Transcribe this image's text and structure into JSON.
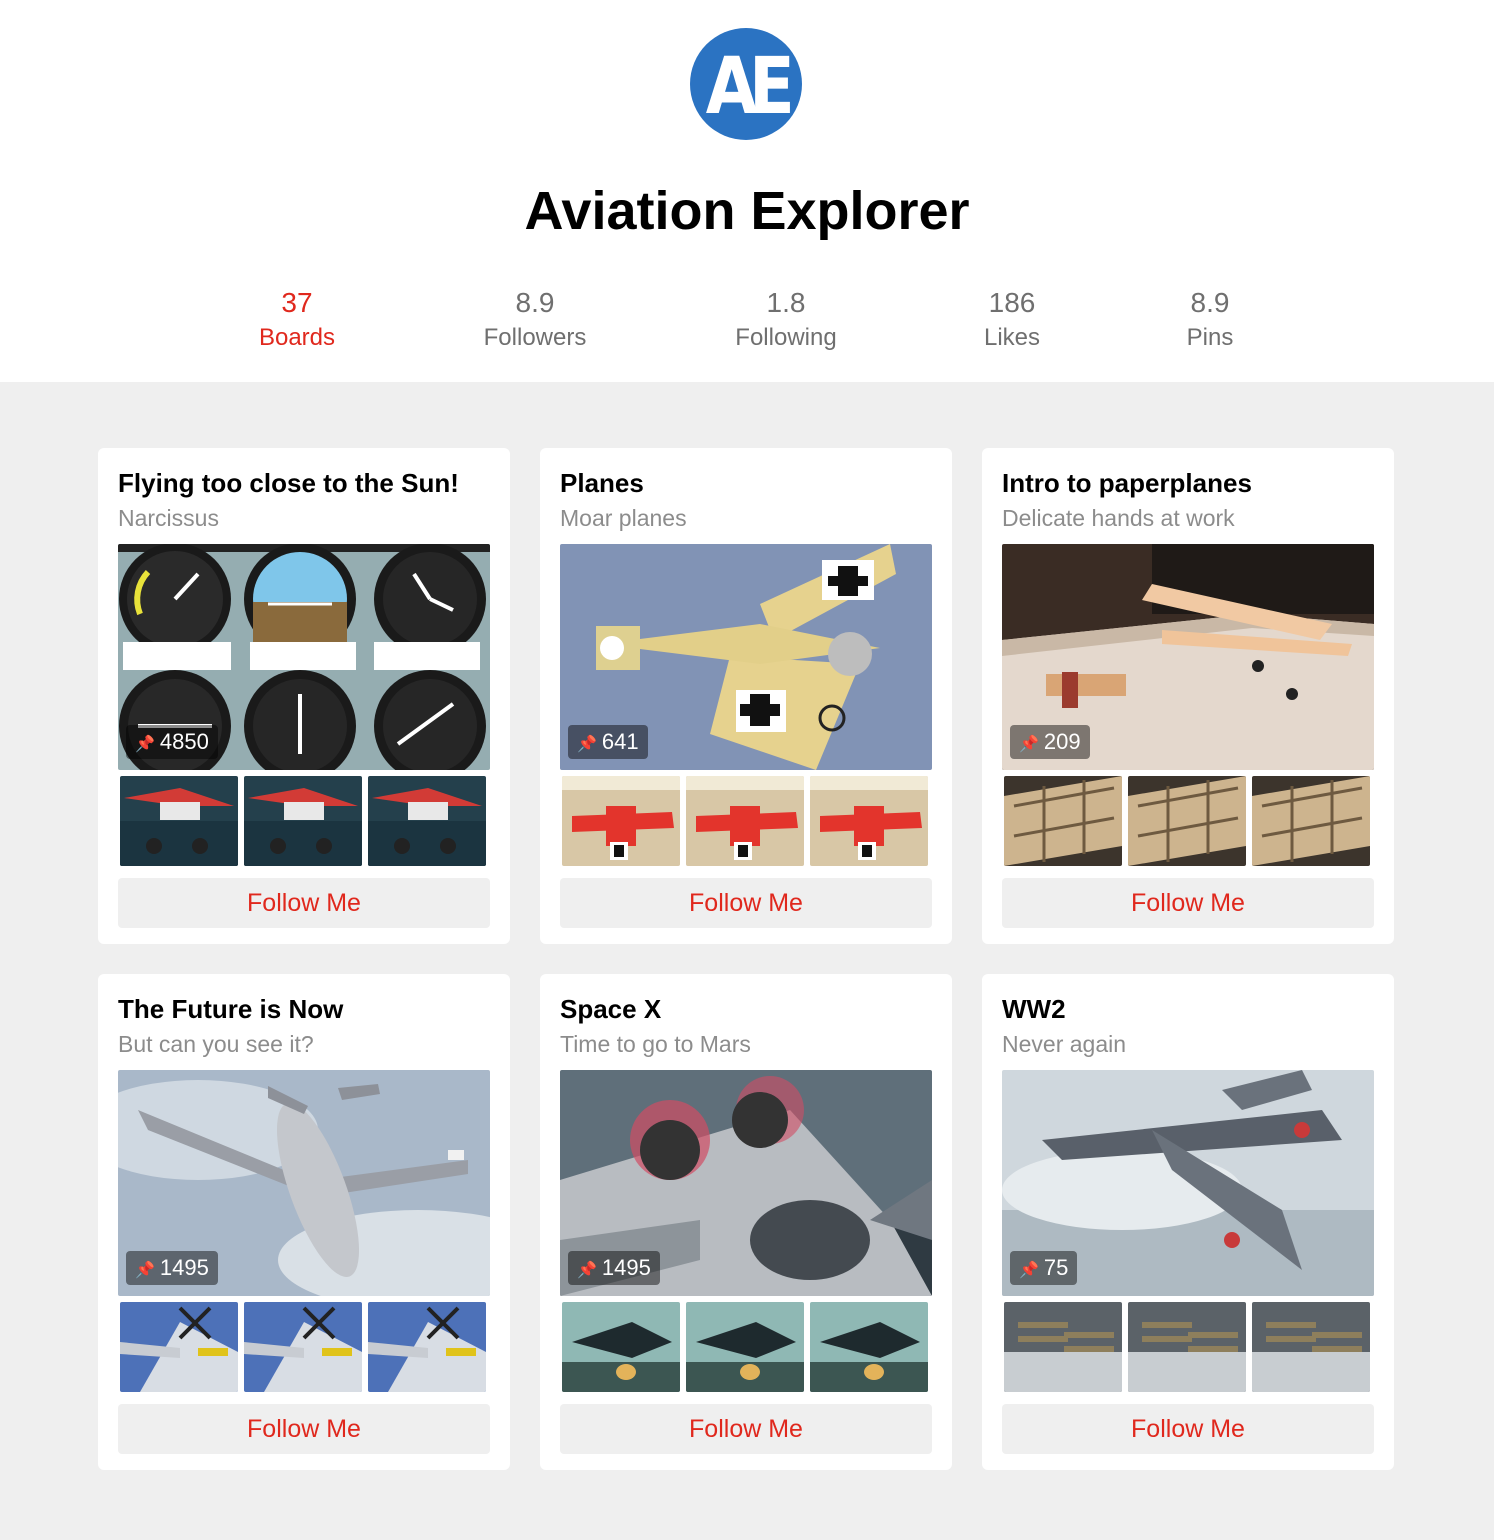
{
  "profile": {
    "logo_text": "AE",
    "name": "Aviation Explorer"
  },
  "stats": [
    {
      "value": "37",
      "label": "Boards",
      "active": true
    },
    {
      "value": "8.9",
      "label": "Followers",
      "active": false
    },
    {
      "value": "1.8",
      "label": "Following",
      "active": false
    },
    {
      "value": "186",
      "label": "Likes",
      "active": false
    },
    {
      "value": "8.9",
      "label": "Pins",
      "active": false
    }
  ],
  "colors": {
    "accent": "#e0281d",
    "logo_blue": "#2b73c2",
    "page_bg": "#efefef",
    "muted_text": "#8c8c8c"
  },
  "boards": [
    {
      "title": "Flying too close to the Sun!",
      "subtitle": "Narcissus",
      "pin_count": "4850",
      "hero_image": "cockpit-instruments-panel",
      "thumb_image": "red-white-propeller-plane",
      "button_label": "Follow Me"
    },
    {
      "title": "Planes",
      "subtitle": "Moar planes",
      "pin_count": "641",
      "hero_image": "ww1-fokker-monoplane",
      "thumb_image": "red-eindecker-model",
      "button_label": "Follow Me"
    },
    {
      "title": "Intro to paperplanes",
      "subtitle": "Delicate hands at work",
      "pin_count": "209",
      "hero_image": "balsa-model-plane-on-table",
      "thumb_image": "balsa-wood-frame",
      "button_label": "Follow Me"
    },
    {
      "title": "The Future is Now",
      "subtitle": "But can you see it?",
      "pin_count": "1495",
      "hero_image": "futuristic-silver-airliner",
      "thumb_image": "usaf-mustang",
      "button_label": "Follow Me"
    },
    {
      "title": "Space X",
      "subtitle": "Time to go to Mars",
      "pin_count": "1495",
      "hero_image": "silver-spacecraft-engines",
      "thumb_image": "dark-spaceship-launch",
      "button_label": "Follow Me"
    },
    {
      "title": "WW2",
      "subtitle": "Never again",
      "pin_count": "75",
      "hero_image": "jet-fighter-painting",
      "thumb_image": "biplanes-storm",
      "button_label": "Follow Me"
    }
  ],
  "icons": {
    "pin": "pushpin-icon"
  }
}
